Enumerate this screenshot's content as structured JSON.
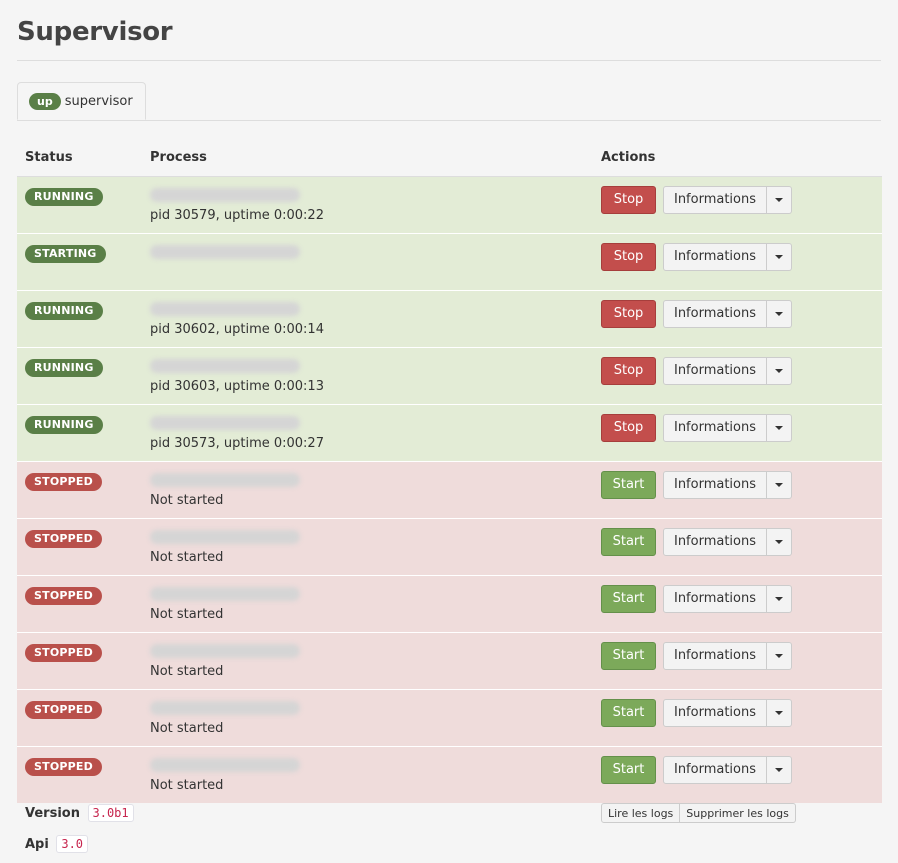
{
  "page": {
    "title": "Supervisor"
  },
  "tabs": [
    {
      "badge": "up",
      "label": "supervisor"
    }
  ],
  "table": {
    "headers": {
      "status": "Status",
      "process": "Process",
      "actions": "Actions"
    },
    "rows": [
      {
        "state": "running",
        "status": "RUNNING",
        "desc": "pid 30579, uptime 0:00:22",
        "action": "Stop",
        "info": "Informations"
      },
      {
        "state": "starting",
        "status": "STARTING",
        "desc": "",
        "action": "Stop",
        "info": "Informations"
      },
      {
        "state": "running",
        "status": "RUNNING",
        "desc": "pid 30602, uptime 0:00:14",
        "action": "Stop",
        "info": "Informations"
      },
      {
        "state": "running",
        "status": "RUNNING",
        "desc": "pid 30603, uptime 0:00:13",
        "action": "Stop",
        "info": "Informations"
      },
      {
        "state": "running",
        "status": "RUNNING",
        "desc": "pid 30573, uptime 0:00:27",
        "action": "Stop",
        "info": "Informations"
      },
      {
        "state": "stopped",
        "status": "STOPPED",
        "desc": "Not started",
        "action": "Start",
        "info": "Informations"
      },
      {
        "state": "stopped",
        "status": "STOPPED",
        "desc": "Not started",
        "action": "Start",
        "info": "Informations"
      },
      {
        "state": "stopped",
        "status": "STOPPED",
        "desc": "Not started",
        "action": "Start",
        "info": "Informations"
      },
      {
        "state": "stopped",
        "status": "STOPPED",
        "desc": "Not started",
        "action": "Start",
        "info": "Informations"
      },
      {
        "state": "stopped",
        "status": "STOPPED",
        "desc": "Not started",
        "action": "Start",
        "info": "Informations"
      },
      {
        "state": "stopped",
        "status": "STOPPED",
        "desc": "Not started",
        "action": "Start",
        "info": "Informations"
      }
    ]
  },
  "footer": {
    "version_label": "Version",
    "version_value": "3.0b1",
    "api_label": "Api",
    "api_value": "3.0",
    "read_logs": "Lire les logs",
    "clear_logs": "Supprimer les logs"
  },
  "colors": {
    "running_row": "#e3ecd6",
    "stopped_row": "#efdcdb",
    "running_badge": "#5a7f47",
    "stopped_badge": "#b9504b",
    "stop_button": "#c34e4c",
    "start_button": "#7ca95a"
  },
  "icons": {
    "dropdown": "caret-down-icon"
  }
}
